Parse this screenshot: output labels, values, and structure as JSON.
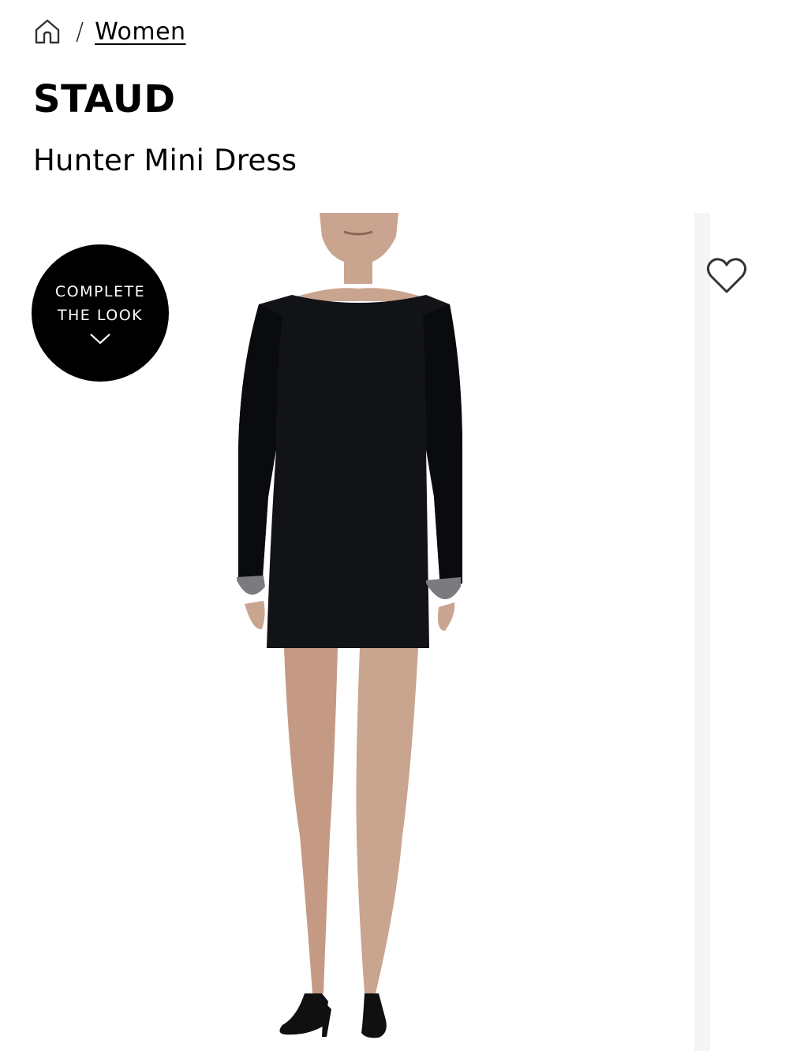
{
  "breadcrumb": {
    "home_icon": "home-icon",
    "separator": "/",
    "link_label": "Women"
  },
  "product": {
    "brand": "STAUD",
    "name": "Hunter Mini Dress"
  },
  "complete_the_look": {
    "line1": "COMPLETE",
    "line2": "THE LOOK",
    "icon": "chevron-down-icon"
  },
  "wishlist": {
    "icon": "heart-icon"
  },
  "gallery": {
    "image_subject": "model-wearing-black-mini-dress"
  }
}
